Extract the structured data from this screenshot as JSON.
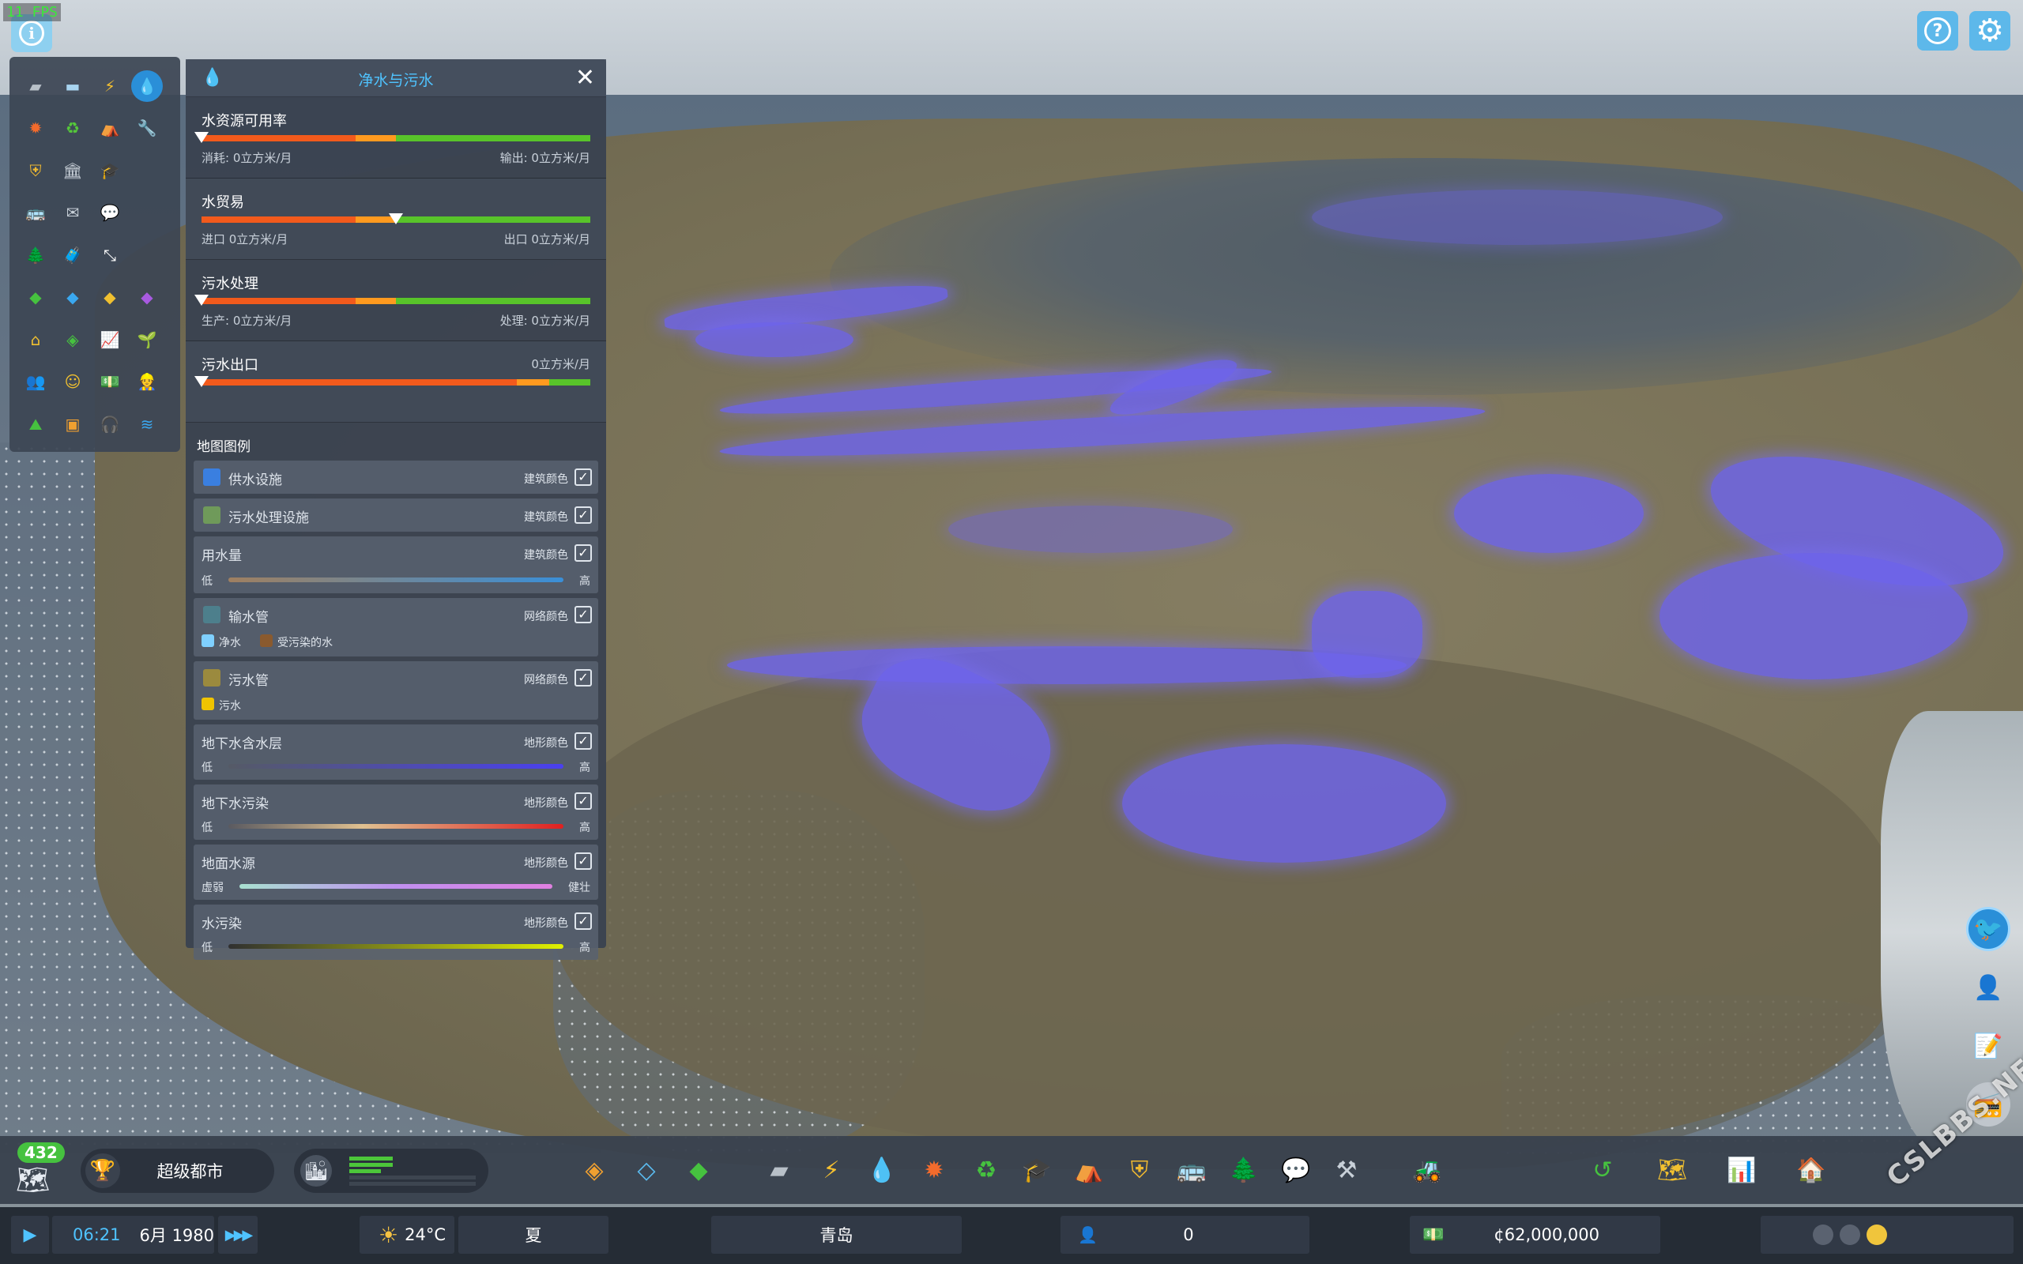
{
  "fps": "11 FPS",
  "colors": {
    "accent": "#4fc3ff",
    "water_overlay": "#6e64eb",
    "bar_red": "#f25a1c",
    "bar_orange": "#ff9a1f",
    "bar_green": "#58c42a",
    "panel_bg": "#3a4350"
  },
  "top_right": {
    "help_icon": "help-icon",
    "settings_icon": "gear-icon"
  },
  "info_views": [
    {
      "name": "roads",
      "icon": "road-icon"
    },
    {
      "name": "buildings",
      "icon": "building-icon"
    },
    {
      "name": "electricity",
      "icon": "bolt-icon"
    },
    {
      "name": "water",
      "icon": "water-drop-icon",
      "active": true
    },
    {
      "name": "fire",
      "icon": "fire-icon"
    },
    {
      "name": "garbage",
      "icon": "recycle-icon"
    },
    {
      "name": "disaster",
      "icon": "shelter-icon"
    },
    {
      "name": "maintenance",
      "icon": "wrench-icon"
    },
    {
      "name": "police",
      "icon": "police-badge-icon"
    },
    {
      "name": "government",
      "icon": "government-icon"
    },
    {
      "name": "education",
      "icon": "graduation-cap-icon"
    },
    {
      "name": "empty",
      "icon": ""
    },
    {
      "name": "transport",
      "icon": "bus-icon"
    },
    {
      "name": "mail",
      "icon": "mail-icon"
    },
    {
      "name": "communication",
      "icon": "chat-bubble-icon"
    },
    {
      "name": "empty",
      "icon": ""
    },
    {
      "name": "parks",
      "icon": "tree-bench-icon"
    },
    {
      "name": "tourism",
      "icon": "suitcase-icon"
    },
    {
      "name": "traffic",
      "icon": "arrows-icon"
    },
    {
      "name": "empty",
      "icon": ""
    },
    {
      "name": "residential",
      "icon": "zone-green-icon"
    },
    {
      "name": "commercial",
      "icon": "zone-blue-icon"
    },
    {
      "name": "industrial",
      "icon": "zone-yellow-icon"
    },
    {
      "name": "office",
      "icon": "zone-purple-icon"
    },
    {
      "name": "land-value",
      "icon": "house-icon"
    },
    {
      "name": "resources",
      "icon": "ore-icon"
    },
    {
      "name": "economy",
      "icon": "graph-icon"
    },
    {
      "name": "fertility",
      "icon": "sprout-icon"
    },
    {
      "name": "health",
      "icon": "citizens-icon"
    },
    {
      "name": "happiness",
      "icon": "smile-icon"
    },
    {
      "name": "money",
      "icon": "money-icon"
    },
    {
      "name": "workers",
      "icon": "workers-icon"
    },
    {
      "name": "terrain",
      "icon": "terrain-icon"
    },
    {
      "name": "agriculture",
      "icon": "crate-icon"
    },
    {
      "name": "noise",
      "icon": "headphones-icon"
    },
    {
      "name": "water-level",
      "icon": "water-level-icon"
    }
  ],
  "panel": {
    "title": "净水与污水",
    "meters": [
      {
        "label": "水资源可用率",
        "left": "消耗:  0立方米/月",
        "right": "输出:  0立方米/月",
        "marker": 0.0,
        "top_right": ""
      },
      {
        "label": "水贸易",
        "left": "进口 0立方米/月",
        "right": "出口 0立方米/月",
        "marker": 0.5,
        "top_right": ""
      },
      {
        "label": "污水处理",
        "left": "生产:  0立方米/月",
        "right": "处理:  0立方米/月",
        "marker": 0.0,
        "top_right": ""
      },
      {
        "label": "污水出口",
        "left": "",
        "right": "",
        "marker": 0.0,
        "top_right": "0立方米/月"
      }
    ],
    "legend_title": "地图图例",
    "legend": {
      "supply": {
        "name": "供水设施",
        "kind": "建筑颜色",
        "color": "#3a7fe0"
      },
      "sewage_fac": {
        "name": "污水处理设施",
        "kind": "建筑颜色",
        "color": "#6f9a5a"
      },
      "usage": {
        "name": "用水量",
        "kind": "建筑颜色",
        "low": "低",
        "high": "高"
      },
      "pipes": {
        "name": "输水管",
        "kind": "网络颜色",
        "color": "#4d7f8c",
        "clean": "净水",
        "clean_color": "#7fd0ff",
        "dirty": "受污染的水",
        "dirty_color": "#8a5a2e"
      },
      "sewer": {
        "name": "污水管",
        "kind": "网络颜色",
        "color": "#9b8a3e",
        "sewage": "污水",
        "sewage_color": "#f0c400"
      },
      "aquifer": {
        "name": "地下水含水层",
        "kind": "地形颜色",
        "low": "低",
        "high": "高"
      },
      "gw_pollution": {
        "name": "地下水污染",
        "kind": "地形颜色",
        "low": "低",
        "high": "高"
      },
      "surface": {
        "name": "地面水源",
        "kind": "地形颜色",
        "low": "虚弱",
        "high": "健壮"
      },
      "water_pollution": {
        "name": "水污染",
        "kind": "地形颜色",
        "low": "低",
        "high": "高"
      }
    }
  },
  "toolbar": {
    "population_badge": "432",
    "milestone": "超级都市",
    "tools": [
      "zoning-icon",
      "area-icon",
      "districts-icon",
      "roads-icon",
      "electricity-icon",
      "water-icon",
      "fire-icon",
      "garbage-icon",
      "education-icon",
      "shelter-icon",
      "police-icon",
      "transport-icon",
      "parks-icon",
      "communication-icon",
      "shovel-icon",
      "bulldozer-icon",
      "undo-icon",
      "map-icon",
      "statistics-icon",
      "home-icon"
    ]
  },
  "side_buttons": [
    "chirper-bird-icon",
    "person-icon",
    "notes-icon",
    "radio-icon"
  ],
  "status": {
    "time": "06:21",
    "date": "6月 1980",
    "temperature": "24°C",
    "season": "夏",
    "city": "青岛",
    "population": "0",
    "money": "¢62,000,000",
    "happiness_level": 3
  },
  "watermark": "CSLBBS.NET"
}
